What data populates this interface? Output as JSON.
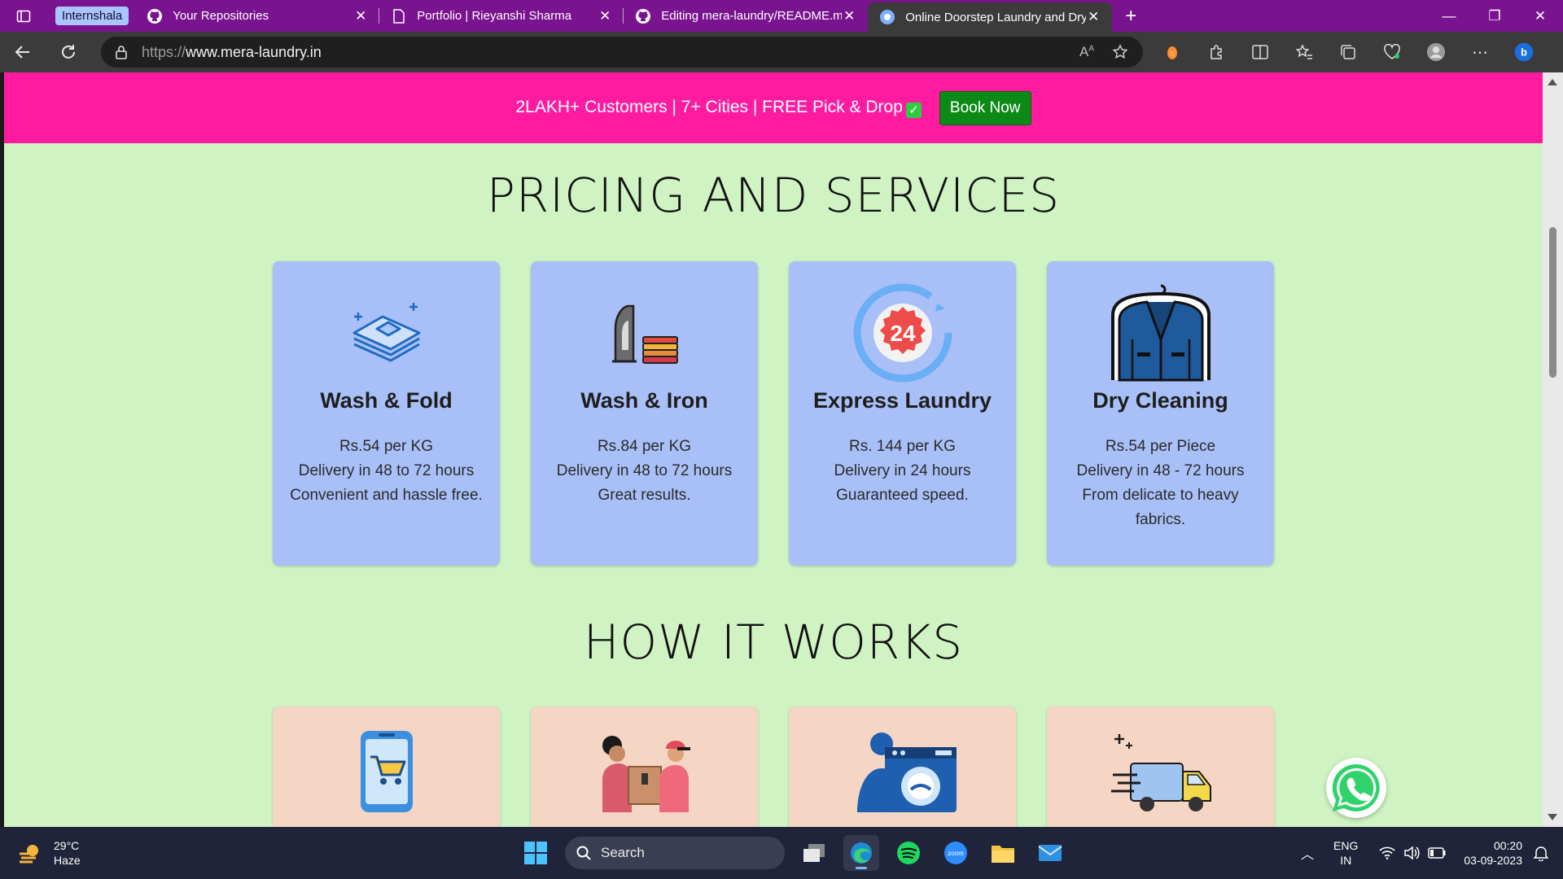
{
  "browser": {
    "tab_group_label": "Internshala",
    "tabs": [
      {
        "title": "Your Repositories",
        "icon": "github-icon"
      },
      {
        "title": "Portfolio | Rieyanshi Sharma",
        "icon": "page-icon"
      },
      {
        "title": "Editing mera-laundry/README.md",
        "icon": "github-icon"
      },
      {
        "title": "Online Doorstep Laundry and Dry Cleaning",
        "icon": "laundry-site-icon",
        "active": true
      }
    ],
    "url_scheme": "https://",
    "url_host": "www.mera-laundry.in"
  },
  "banner": {
    "text": "2LAKH+ Customers | 7+ Cities | FREE Pick & Drop",
    "check_glyph": "✓",
    "book_label": "Book Now",
    "colors": {
      "background": "#ff1ba0",
      "button": "#0b8a17"
    }
  },
  "pricing": {
    "title": "PRICING AND SERVICES",
    "cards": [
      {
        "name": "Wash & Fold",
        "line1": "Rs.54 per KG",
        "line2": "Delivery in 48 to 72 hours",
        "line3": "Convenient and hassle free.",
        "icon": "folded-clothes-icon"
      },
      {
        "name": "Wash & Iron",
        "line1": "Rs.84 per KG",
        "line2": "Delivery in 48 to 72 hours",
        "line3": "Great results.",
        "icon": "iron-icon"
      },
      {
        "name": "Express Laundry",
        "line1": "Rs. 144 per KG",
        "line2": "Delivery in 24 hours",
        "line3": "Guaranteed speed.",
        "icon": "24-hour-icon"
      },
      {
        "name": "Dry Cleaning",
        "line1": "Rs.54 per Piece",
        "line2": "Delivery in 48 - 72 hours",
        "line3": "From delicate to heavy fabrics.",
        "icon": "jacket-on-hanger-icon"
      }
    ]
  },
  "how": {
    "title": "HOW IT WORKS",
    "icons": [
      "mobile-cart-icon",
      "pickup-handover-icon",
      "washing-machine-icon",
      "delivery-truck-icon"
    ]
  },
  "taskbar": {
    "temp": "29°C",
    "weather": "Haze",
    "search_label": "Search",
    "lang1": "ENG",
    "lang2": "IN",
    "time": "00:20",
    "date": "03-09-2023"
  },
  "colors": {
    "page_bg": "#cff3c2",
    "card_bg": "#a8c0f7",
    "how_card_bg": "#f5d5c4",
    "tabbar": "#7a1390"
  }
}
